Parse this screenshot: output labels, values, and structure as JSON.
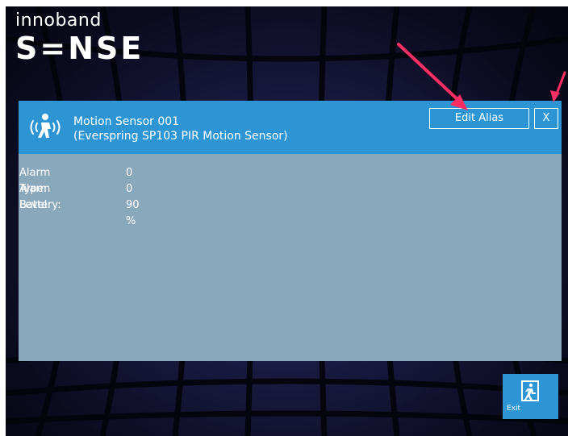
{
  "logo": {
    "top_text": "innoband",
    "bottom_text": "S=NSE"
  },
  "panel": {
    "sensor_name": "Motion Sensor 001",
    "sensor_model": "(Everspring SP103 PIR Motion Sensor)",
    "edit_alias_label": "Edit Alias",
    "close_label": "X",
    "rows": [
      {
        "label": "Alarm Type:",
        "value": "0"
      },
      {
        "label": "Alarm Level:",
        "value": "0"
      },
      {
        "label": "Battery:",
        "value": "90 %"
      }
    ]
  },
  "exit": {
    "label": "Exit"
  },
  "colors": {
    "header_blue": "#2d95d3",
    "panel_gray_blue": "#8aa8bb",
    "annotation_arrow": "#ff2e63"
  },
  "icons": [
    "motion-sensor-icon",
    "exit-door-icon",
    "annotation-arrow"
  ]
}
